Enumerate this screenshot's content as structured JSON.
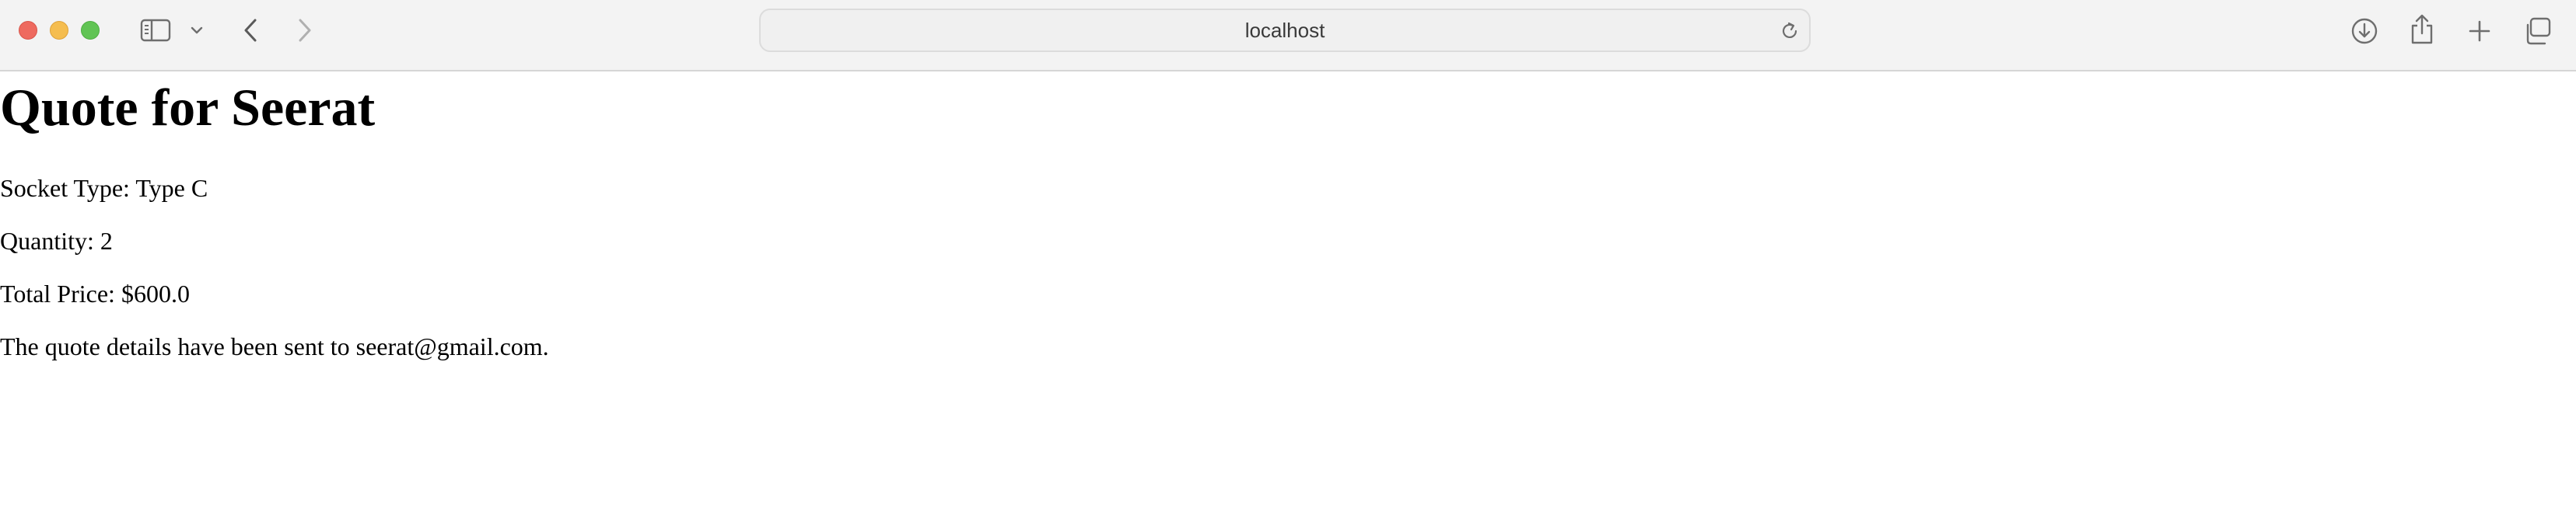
{
  "browser": {
    "address": "localhost"
  },
  "page": {
    "title": "Quote for Seerat",
    "socket_type": "Socket Type: Type C",
    "quantity": "Quantity: 2",
    "total_price": "Total Price: $600.0",
    "confirmation": "The quote details have been sent to seerat@gmail.com."
  },
  "icons": {
    "close": "close-window-icon",
    "minimize": "minimize-window-icon",
    "maximize": "maximize-window-icon",
    "sidebar": "sidebar-icon",
    "sidebar_menu": "chevron-down-icon",
    "back": "chevron-left-icon",
    "forward": "chevron-right-icon",
    "reload": "reload-icon",
    "downloads": "download-icon",
    "share": "share-icon",
    "new_tab": "plus-icon",
    "tab_overview": "tabs-icon"
  },
  "colors": {
    "close": "#ee6a5f",
    "minimize": "#f5bd4f",
    "maximize": "#61c454",
    "toolbar_bg": "#f3f3f3",
    "page_bg": "#ffffff",
    "text": "#000000"
  }
}
